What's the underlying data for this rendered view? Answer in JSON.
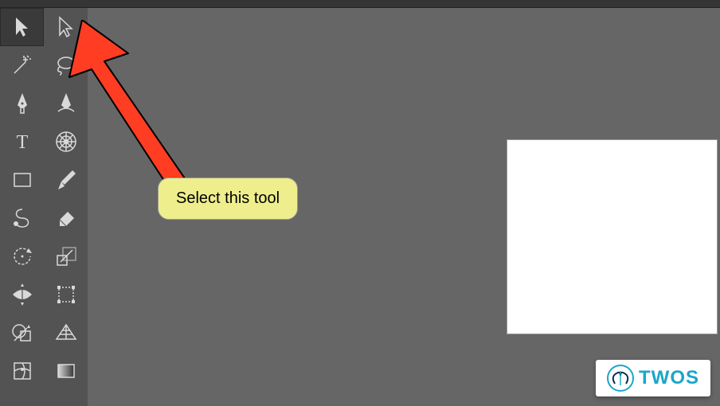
{
  "annotation": {
    "callout_text": "Select this tool"
  },
  "watermark": {
    "text": "TWOS"
  },
  "toolbox": {
    "selected_index": 0,
    "tools": [
      "selection-tool",
      "direct-selection-tool",
      "magic-wand-tool",
      "lasso-tool",
      "pen-tool",
      "curvature-tool",
      "type-tool",
      "polar-grid-tool",
      "rectangle-tool",
      "paintbrush-tool",
      "shaper-tool",
      "eraser-tool",
      "rotate-tool",
      "scale-tool",
      "width-tool",
      "free-transform-tool",
      "shape-builder-tool",
      "perspective-grid-tool",
      "mesh-tool",
      "gradient-tool"
    ]
  }
}
